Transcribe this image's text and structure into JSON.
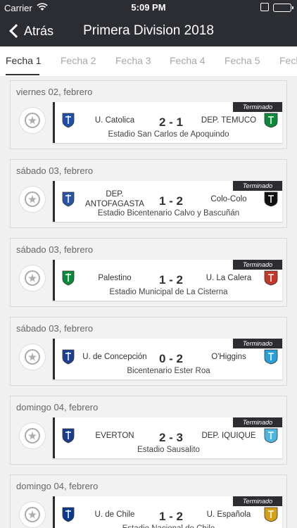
{
  "status_bar": {
    "carrier": "Carrier",
    "time": "5:09 PM"
  },
  "nav": {
    "back_label": "Atrás",
    "title": "Primera Division 2018"
  },
  "tabs": [
    "Fecha 1",
    "Fecha 2",
    "Fecha 3",
    "Fecha 4",
    "Fecha 5",
    "Fech"
  ],
  "matches": [
    {
      "date": "viernes 02, febrero",
      "status": "Terminado",
      "home": "U. Catolica",
      "score": "2 - 1",
      "away": "DEP. TEMUCO",
      "stadium": "Estadio San Carlos de Apoquindo",
      "home_color": "#1f4fa8",
      "away_color": "#0c8a3a"
    },
    {
      "date": "sábado 03, febrero",
      "status": "Terminado",
      "home": "DEP. ANTOFAGASTA",
      "score": "1 - 2",
      "away": "Colo-Colo",
      "stadium": "Estadio Bicentenario Calvo y Bascuñán",
      "home_color": "#2a55a5",
      "away_color": "#111111"
    },
    {
      "date": "sábado 03, febrero",
      "status": "Terminado",
      "home": "Palestino",
      "score": "1 - 2",
      "away": "U. La Calera",
      "stadium": "Estadio Municipal de La Cisterna",
      "home_color": "#0a8a3c",
      "away_color": "#c0392b"
    },
    {
      "date": "sábado 03, febrero",
      "status": "Terminado",
      "home": "U. de Concepción",
      "score": "0 - 2",
      "away": "O'Higgins",
      "stadium": "Bicentenario Ester Roa",
      "home_color": "#1d3f8f",
      "away_color": "#2aa0d8"
    },
    {
      "date": "domingo 04, febrero",
      "status": "Terminado",
      "home": "EVERTON",
      "score": "2 - 3",
      "away": "DEP. IQUIQUE",
      "stadium": "Estadio Sausalito",
      "home_color": "#1a3d8a",
      "away_color": "#4db6e0"
    },
    {
      "date": "domingo 04, febrero",
      "status": "Terminado",
      "home": "U. de Chile",
      "score": "1 - 2",
      "away": "U. Española",
      "stadium": "Estadio Nacional de Chile",
      "home_color": "#0b3a8c",
      "away_color": "#d4a017"
    }
  ]
}
